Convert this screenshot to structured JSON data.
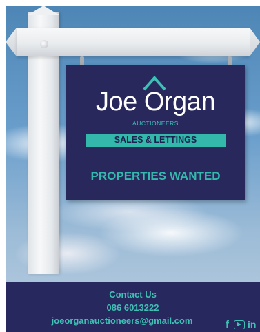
{
  "sign": {
    "brand": "Joe Organ",
    "subtitle": "AUCTIONEERS",
    "tagline": "SALES & LETTINGS",
    "headline": "PROPERTIES WANTED"
  },
  "footer": {
    "contact_label": "Contact Us",
    "phone": "086 6013222",
    "email": "joeorganauctioneers@gmail.com"
  },
  "social": {
    "facebook_glyph": "f",
    "linkedin_glyph": "in",
    "icons": [
      "facebook-icon",
      "youtube-icon",
      "linkedin-icon"
    ]
  },
  "colors": {
    "navy": "#28285c",
    "teal": "#34b8ab",
    "footer": "#27285e"
  }
}
